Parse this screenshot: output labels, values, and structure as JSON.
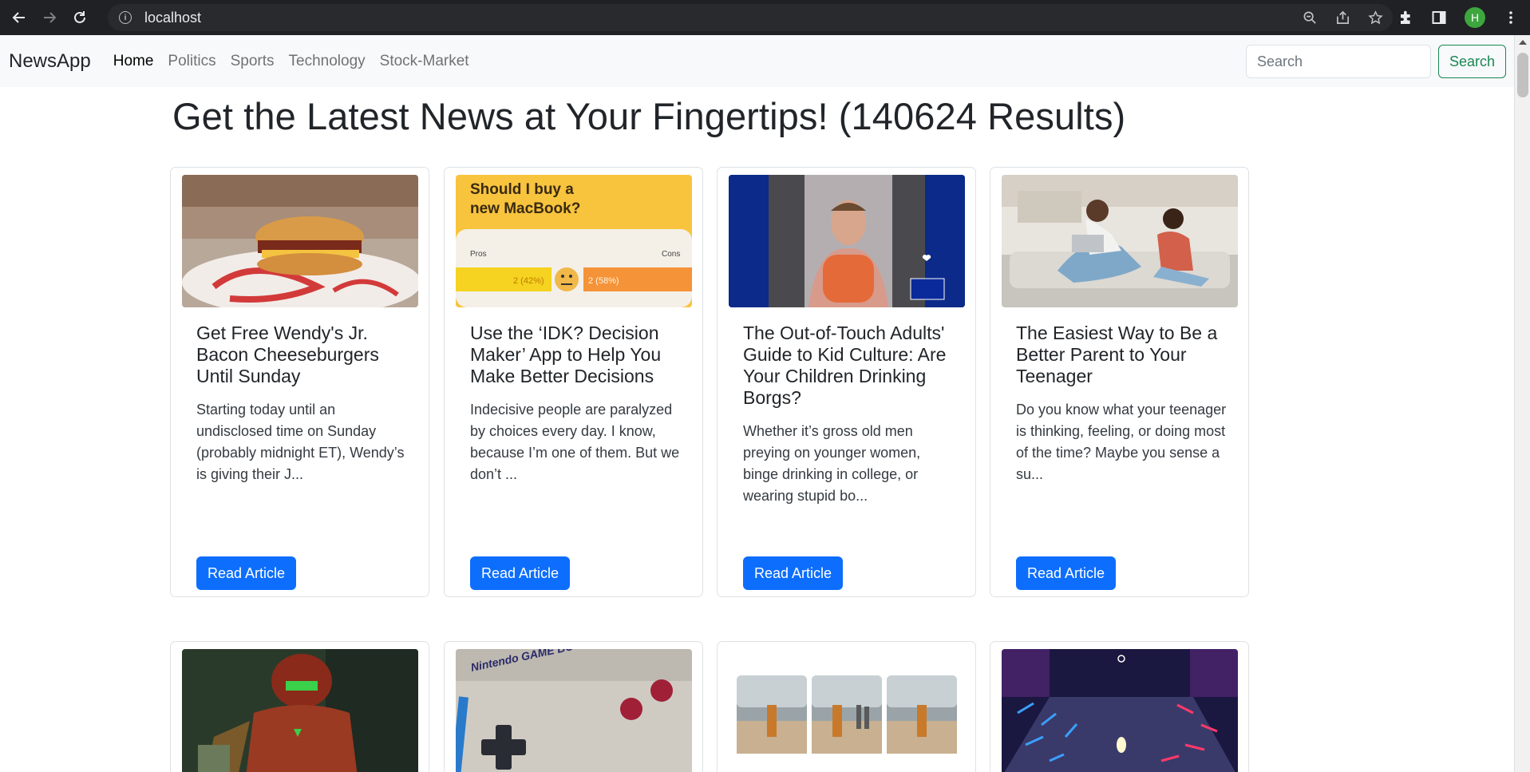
{
  "browser": {
    "url": "localhost",
    "avatar_letter": "H"
  },
  "navbar": {
    "brand": "NewsApp",
    "links": [
      "Home",
      "Politics",
      "Sports",
      "Technology",
      "Stock-Market"
    ],
    "active_link": "Home",
    "search_placeholder": "Search",
    "search_button": "Search"
  },
  "headline": "Get the Latest News at Your Fingertips! (140624 Results)",
  "colors": {
    "primary": "#0d6efd",
    "success": "#198754",
    "navbar_bg": "#f8f9fa",
    "chrome_bg": "#202124"
  },
  "articles": [
    {
      "title": "Get Free Wendy's Jr. Bacon Cheeseburgers Until Sunday",
      "description": "Starting today until an undisclosed time on Sunday (probably midnight ET), Wendy’s is giving their J...",
      "button": "Read Article",
      "image": "burger-photo"
    },
    {
      "title": "Use the ‘IDK? Decision Maker’ App to Help You Make Better Decisions",
      "description": "Indecisive people are paralyzed by choices every day. I know, because I’m one of them. But we don’t ...",
      "button": "Read Article",
      "image": "macbook-poll-graphic",
      "image_text": {
        "question": "Should I buy a new MacBook?",
        "pros": "Pros",
        "cons": "Cons",
        "pro_value": "2 (42%)",
        "con_value": "2 (58%)"
      }
    },
    {
      "title": "The Out-of-Touch Adults' Guide to Kid Culture: Are Your Children Drinking Borgs?",
      "description": "Whether it’s gross old men preying on younger women, binge drinking in college, or wearing stupid bo...",
      "button": "Read Article",
      "image": "person-with-jug-photo"
    },
    {
      "title": "The Easiest Way to Be a Better Parent to Your Teenager",
      "description": "Do you know what your teenager is thinking, feeling, or doing most of the time? Maybe you sense a su...",
      "button": "Read Article",
      "image": "parent-teen-couch-photo"
    },
    {
      "image": "armored-robot-photo"
    },
    {
      "image": "game-boy-photo"
    },
    {
      "image": "beach-figures-photo"
    },
    {
      "image": "neon-arena-photo"
    }
  ]
}
